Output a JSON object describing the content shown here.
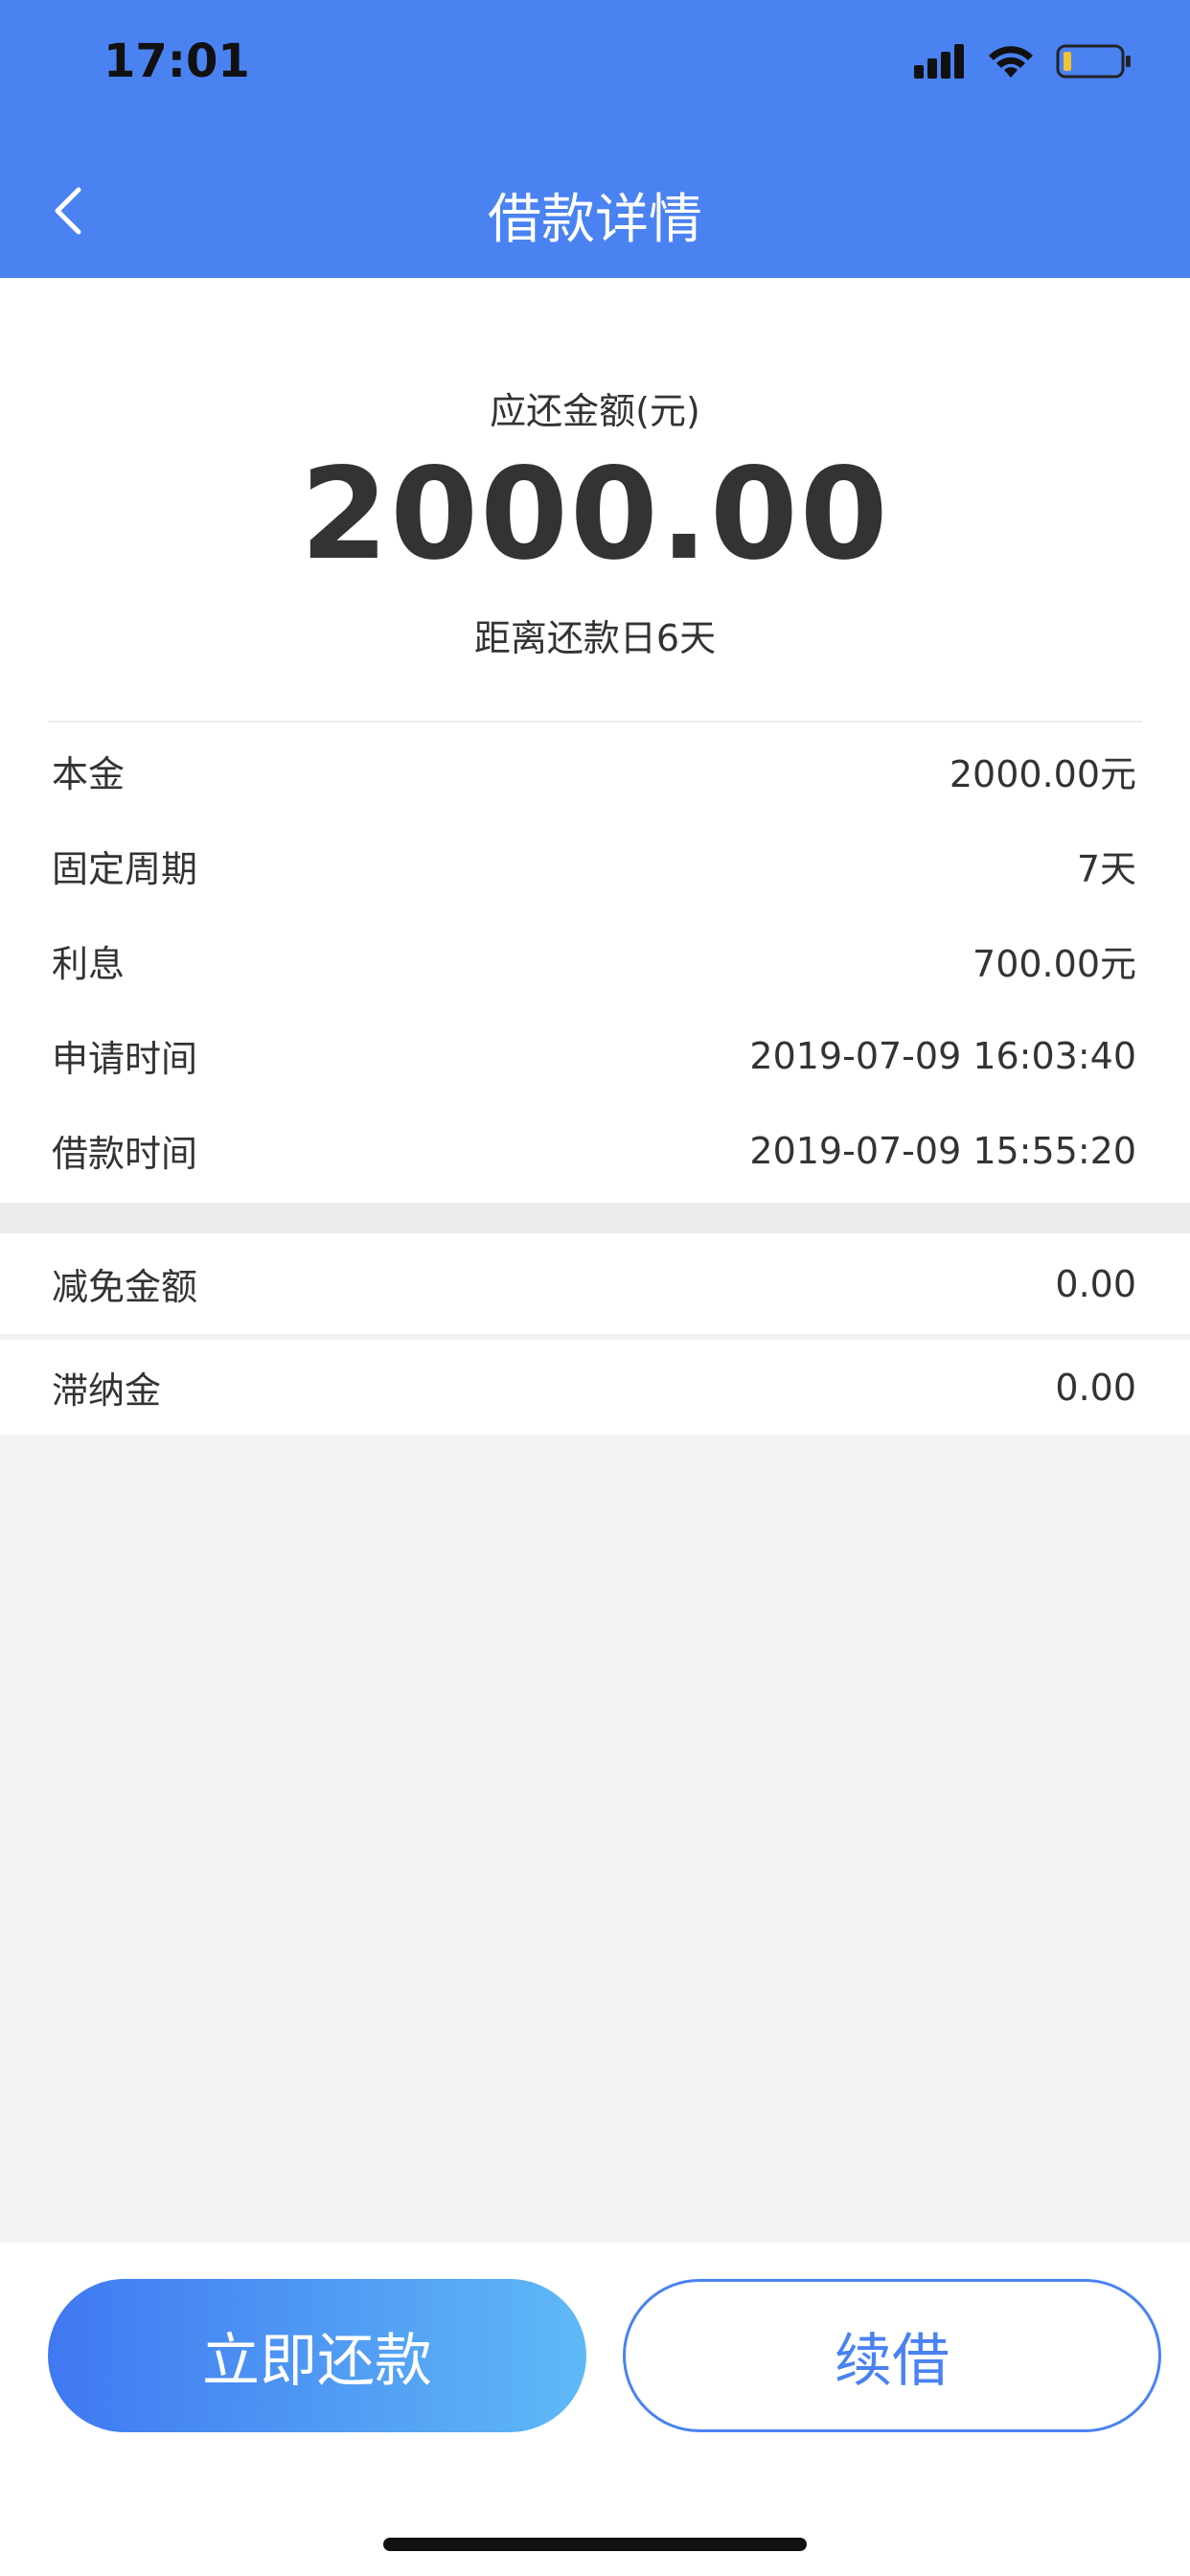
{
  "status_bar": {
    "time": "17:01"
  },
  "header": {
    "title": "借款详情"
  },
  "summary": {
    "label": "应还金额(元)",
    "amount": "2000.00",
    "days_until_due": "距离还款日6天"
  },
  "details": [
    {
      "label": "本金",
      "value": "2000.00元"
    },
    {
      "label": "固定周期",
      "value": "7天"
    },
    {
      "label": "利息",
      "value": "700.00元"
    },
    {
      "label": "申请时间",
      "value": "2019-07-09 16:03:40"
    },
    {
      "label": "借款时间",
      "value": "2019-07-09 15:55:20"
    }
  ],
  "extras": [
    {
      "label": "减免金额",
      "value": "0.00"
    },
    {
      "label": "滞纳金",
      "value": "0.00"
    }
  ],
  "actions": {
    "repay_label": "立即还款",
    "renew_label": "续借"
  },
  "colors": {
    "header": "#4a82f2",
    "primary_gradient_start": "#3f78f1",
    "primary_gradient_end": "#5fb9f6",
    "secondary_border": "#4a82f2"
  },
  "icons": {
    "back": "chevron-left-icon",
    "signal": "signal-icon",
    "wifi": "wifi-icon",
    "battery": "battery-icon"
  }
}
